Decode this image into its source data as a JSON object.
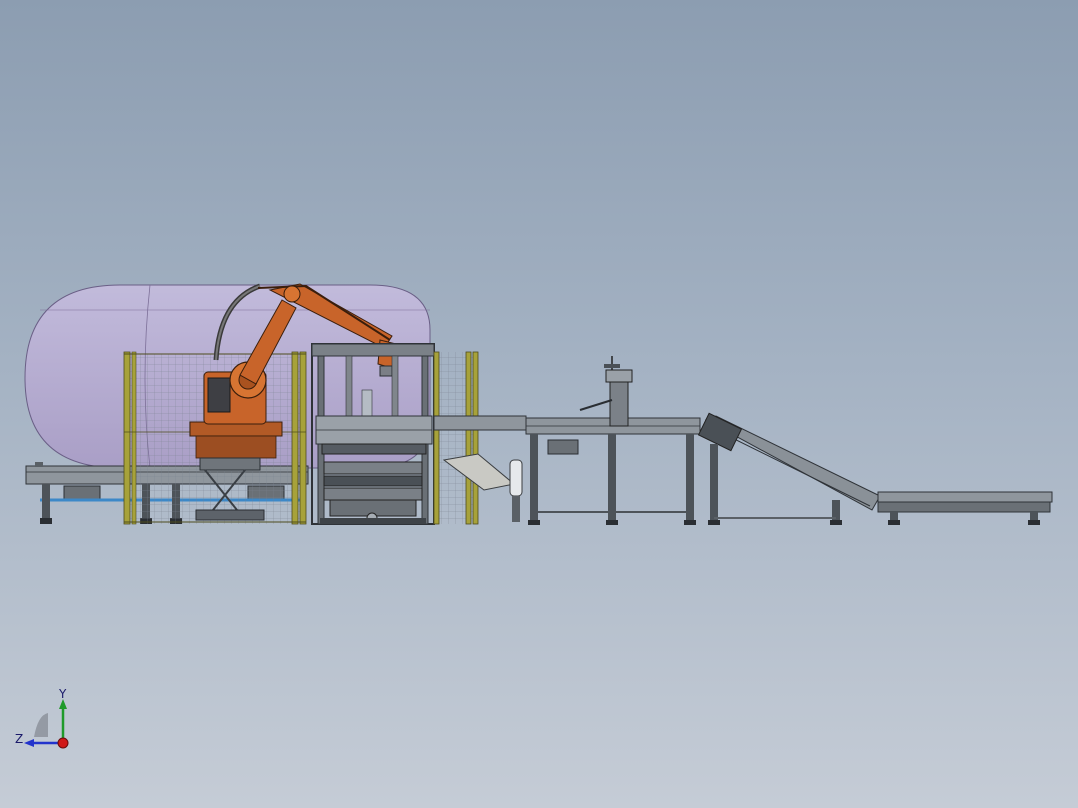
{
  "view": {
    "background_top": "#8c9db1",
    "background_bottom": "#c5ccd6"
  },
  "triad": {
    "y_label": "Y",
    "z_label": "Z",
    "y_axis_color": "#1f9a2a",
    "z_axis_color": "#2233cc",
    "x_axis_color": "#d01818"
  },
  "colors": {
    "robot": "#c8642a",
    "safety_fence": "#a7a23a",
    "conveyor_frame": "#4f565d",
    "envelope": "#b8a6d3"
  }
}
